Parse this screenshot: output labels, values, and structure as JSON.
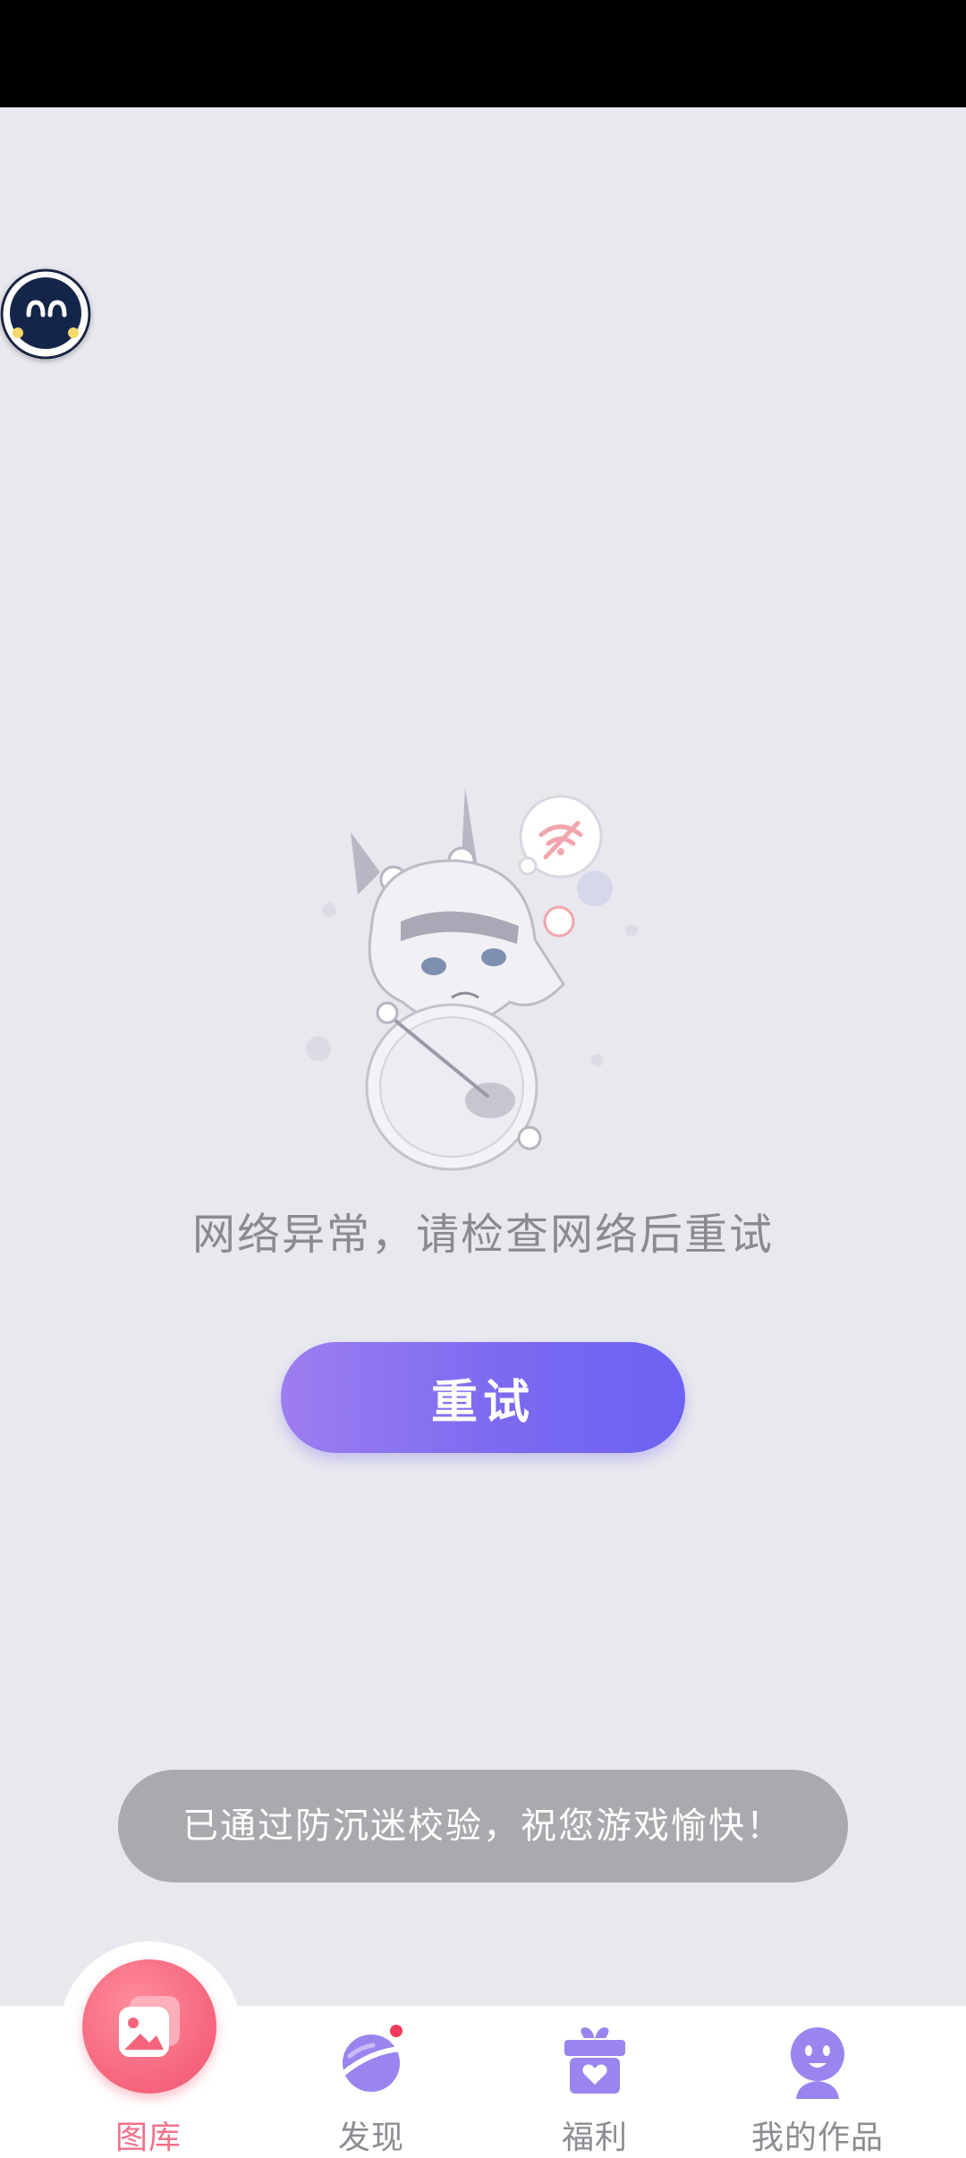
{
  "error": {
    "message": "网络异常，请检查网络后重试",
    "retry_label": "重试"
  },
  "toast": {
    "message": "已通过防沉迷校验，祝您游戏愉快！"
  },
  "tabs": [
    {
      "label": "图库",
      "icon": "gallery-icon",
      "active": true
    },
    {
      "label": "发现",
      "icon": "planet-icon",
      "active": false
    },
    {
      "label": "福利",
      "icon": "gift-icon",
      "active": false
    },
    {
      "label": "我的作品",
      "icon": "profile-icon",
      "active": false
    }
  ],
  "colors": {
    "background": "#e8e8ee",
    "accent": "#7b6af0",
    "active_tab": "#f0728a",
    "tab_icon": "#9a84ee"
  }
}
